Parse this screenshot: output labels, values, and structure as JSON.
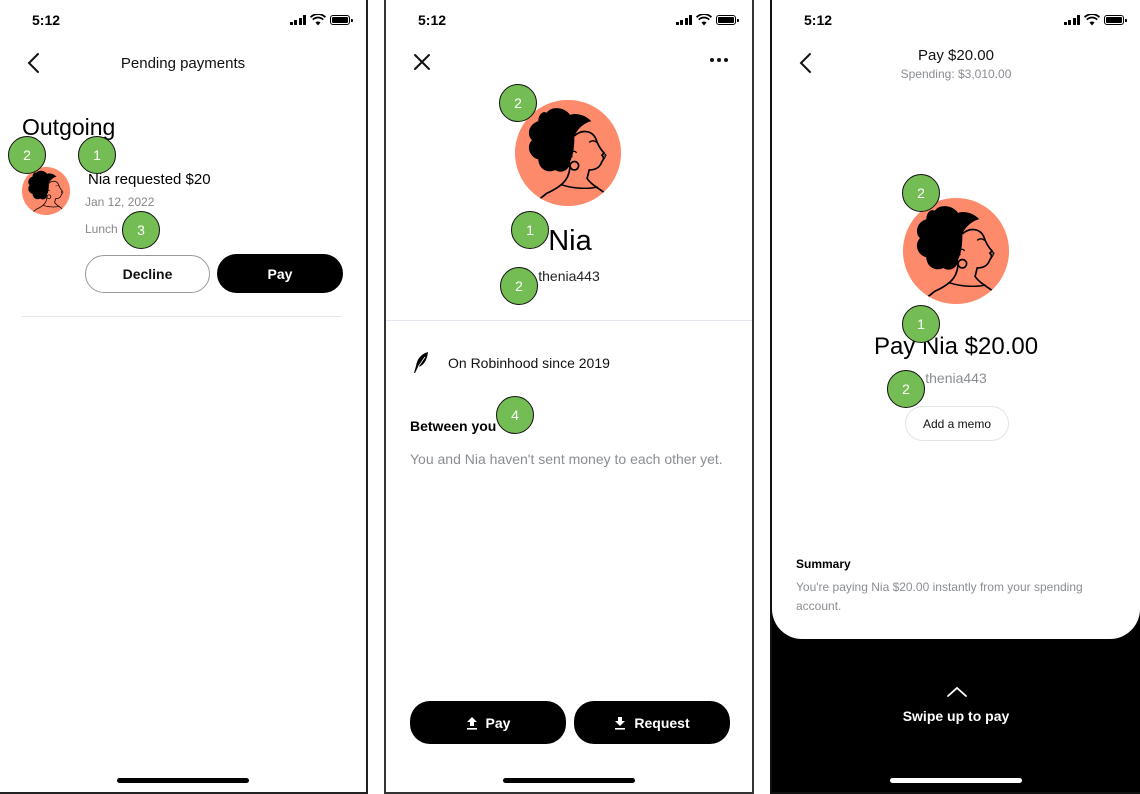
{
  "status_bar": {
    "time": "5:12"
  },
  "screen1": {
    "nav_title": "Pending payments",
    "section_heading": "Outgoing",
    "request": {
      "title": "Nia requested $20",
      "date": "Jan 12, 2022",
      "memo": "Lunch",
      "decline_label": "Decline",
      "pay_label": "Pay"
    },
    "annotations": [
      "1",
      "2",
      "3"
    ]
  },
  "screen2": {
    "name": "Nia",
    "handle": "thenia443",
    "member_since": "On Robinhood since 2019",
    "between_heading": "Between you",
    "between_text": "You and Nia haven't sent money to each other yet.",
    "pay_label": "Pay",
    "request_label": "Request",
    "annotations": [
      "2",
      "1",
      "2",
      "4"
    ]
  },
  "screen3": {
    "title": "Pay $20.00",
    "subtitle": "Spending: $3,010.00",
    "main_text": "Pay Nia $20.00",
    "handle": "thenia443",
    "memo_label": "Add a memo",
    "summary_heading": "Summary",
    "summary_text": "You're paying Nia $20.00 instantly from your spending account.",
    "swipe_label": "Swipe up to pay",
    "annotations": [
      "2",
      "1",
      "2"
    ]
  },
  "colors": {
    "avatar_bg": "#fd8b6b",
    "badge_green": "#74bd54",
    "secondary_text": "#8a8d92"
  }
}
